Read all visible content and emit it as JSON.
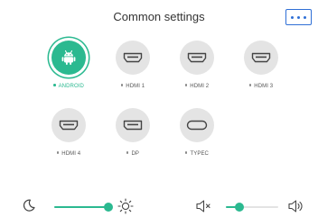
{
  "header": {
    "title": "Common settings"
  },
  "sources": [
    {
      "label": "ANDROID",
      "icon": "android-icon",
      "active": true
    },
    {
      "label": "HDMI 1",
      "icon": "hdmi-port-icon",
      "active": false
    },
    {
      "label": "HDMI 2",
      "icon": "hdmi-port-icon",
      "active": false
    },
    {
      "label": "HDMI 3",
      "icon": "hdmi-port-icon",
      "active": false
    },
    {
      "label": "HDMI 4",
      "icon": "hdmi-port-icon",
      "active": false
    },
    {
      "label": "DP",
      "icon": "displayport-icon",
      "active": false
    },
    {
      "label": "TYPEC",
      "icon": "usb-c-port-icon",
      "active": false
    }
  ],
  "brightness": {
    "min_icon": "moon-icon",
    "max_icon": "sun-icon",
    "level": 1.0
  },
  "volume": {
    "min_icon": "speaker-mute-icon",
    "max_icon": "speaker-loud-icon",
    "level": 0.25
  },
  "colors": {
    "accent": "#2bb990",
    "more_button": "#2f6fd6",
    "inactive_circle": "#e4e4e4"
  }
}
